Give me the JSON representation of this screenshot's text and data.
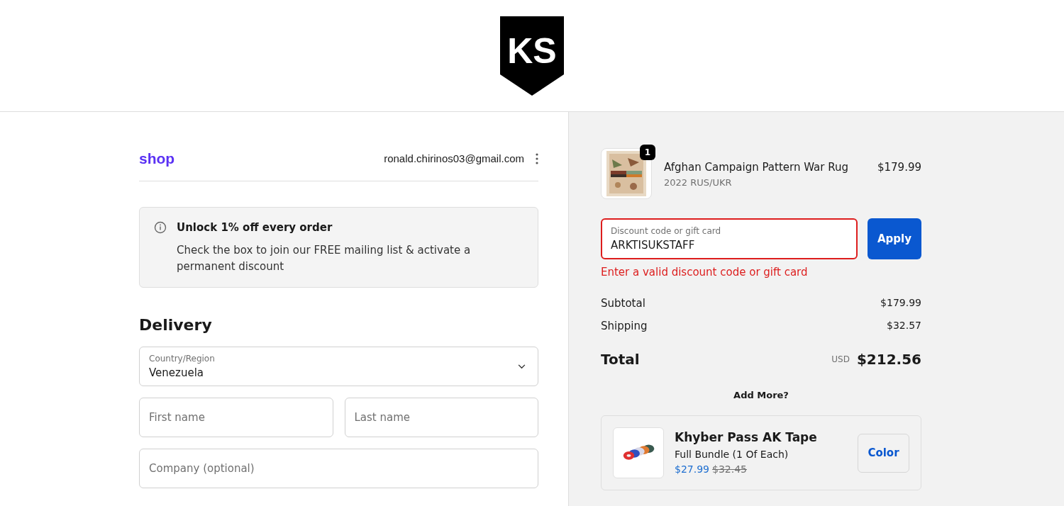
{
  "logo": {
    "text": "KS"
  },
  "account": {
    "brand": "shop",
    "email": "ronald.chirinos03@gmail.com"
  },
  "notice": {
    "title": "Unlock 1% off every order",
    "body": "Check the box to join our FREE mailing list & activate a permanent discount"
  },
  "delivery": {
    "heading": "Delivery",
    "country": {
      "label": "Country/Region",
      "value": "Venezuela"
    },
    "fields": [
      {
        "placeholder": "First name"
      },
      {
        "placeholder": "Last name"
      },
      {
        "placeholder": "Company (optional)"
      }
    ]
  },
  "order": {
    "items": [
      {
        "quantity": "1",
        "name": "Afghan Campaign Pattern War Rug",
        "variant": "2022 RUS/UKR",
        "price": "$179.99"
      }
    ],
    "discount": {
      "label": "Discount code or gift card",
      "value": "ARKTISUKSTAFF",
      "invalid": true,
      "button": "Apply",
      "error": "Enter a valid discount code or gift card"
    },
    "lines": [
      {
        "label": "Subtotal",
        "value": "$179.99"
      },
      {
        "label": "Shipping",
        "value": "$32.57"
      }
    ],
    "total": {
      "label": "Total",
      "currency": "USD",
      "value": "$212.56"
    },
    "upsell": {
      "heading": "Add More?",
      "name": "Khyber Pass AK Tape",
      "variant": "Full Bundle (1 Of Each)",
      "price": "$27.99",
      "compare_price": "$32.45",
      "button": "Color"
    }
  }
}
